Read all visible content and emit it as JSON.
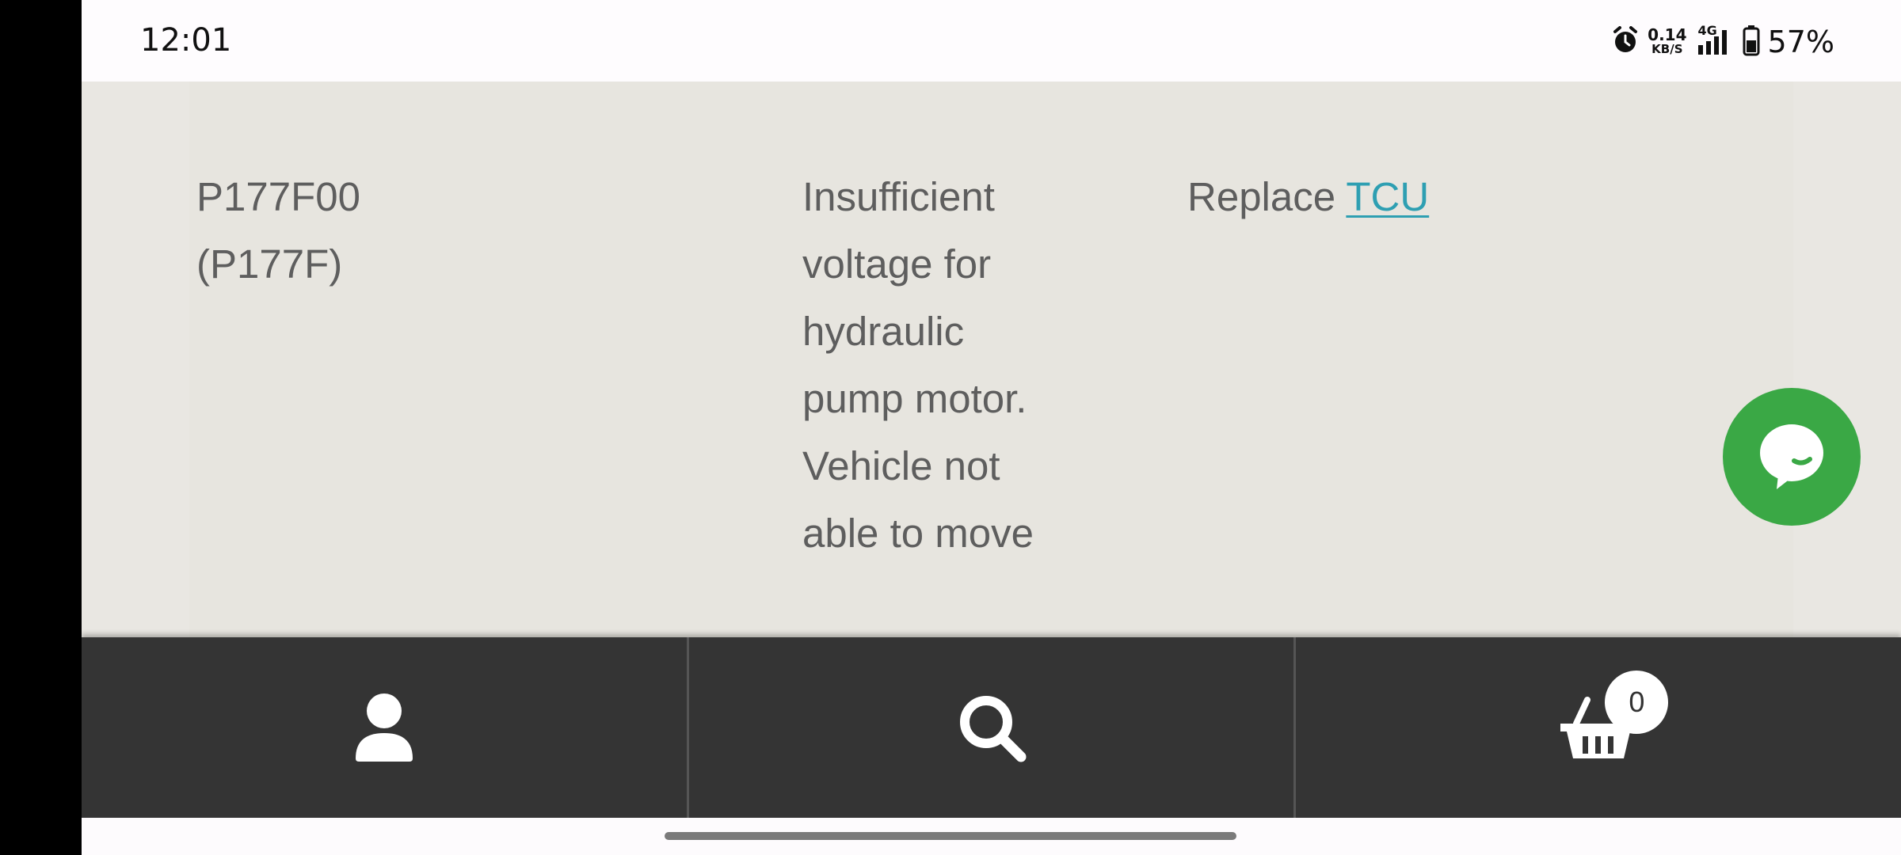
{
  "status_bar": {
    "time": "12:01",
    "net_speed_value": "0.14",
    "net_speed_unit": "KB/S",
    "network_type": "4G",
    "battery": "57%",
    "icons": [
      "alarm-icon",
      "signal-icon",
      "battery-icon"
    ]
  },
  "table_row": {
    "code_line1": "P177F00",
    "code_line2": "(P177F)",
    "description_lines": [
      "Insufficient",
      "voltage for",
      "hydraulic",
      "pump motor.",
      "Vehicle not",
      "able to move"
    ],
    "action_prefix": "Replace ",
    "action_link": "TCU"
  },
  "chat": {
    "icon": "chat-bubble-icon",
    "color": "#3aa845"
  },
  "bottom_nav": {
    "items": [
      {
        "icon": "user-icon"
      },
      {
        "icon": "search-icon"
      },
      {
        "icon": "basket-icon"
      }
    ],
    "cart_count": "0"
  },
  "colors": {
    "content_bg": "#e7e5df",
    "text": "#5e5e5e",
    "link": "#2e9fb2",
    "bottom_bar": "#343434"
  }
}
